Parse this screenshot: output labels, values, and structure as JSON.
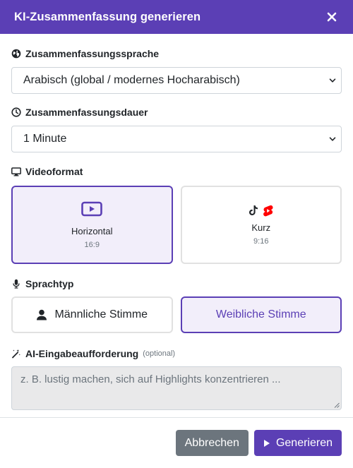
{
  "modal": {
    "title": "KI-Zusammenfassung generieren",
    "close_icon": "close-icon"
  },
  "language": {
    "label": "Zusammenfassungssprache",
    "icon": "globe-icon",
    "selected": "Arabisch (global / modernes Hocharabisch)"
  },
  "duration": {
    "label": "Zusammenfassungsdauer",
    "icon": "clock-icon",
    "selected": "1 Minute"
  },
  "format": {
    "label": "Videoformat",
    "icon": "monitor-icon",
    "options": [
      {
        "name": "Horizontal",
        "ratio": "16:9",
        "icon": "youtube-icon",
        "selected": true
      },
      {
        "name": "Kurz",
        "ratio": "9:16",
        "icon": "tiktok-shorts-icon",
        "selected": false
      }
    ]
  },
  "voice": {
    "label": "Sprachtyp",
    "icon": "microphone-icon",
    "options": [
      {
        "label": "Männliche Stimme",
        "icon": "user-icon",
        "selected": false
      },
      {
        "label": "Weibliche Stimme",
        "selected": true
      }
    ]
  },
  "prompt": {
    "label": "AI-Eingabeaufforderung",
    "optional": "(optional)",
    "icon": "magic-wand-icon",
    "placeholder": "z. B. lustig machen, sich auf Highlights konzentrieren ..."
  },
  "footer": {
    "cancel_label": "Abbrechen",
    "submit_label": "Generieren",
    "submit_icon": "play-icon"
  },
  "colors": {
    "accent": "#5b3fb5",
    "selected_bg": "#f2eefa",
    "tiktok_shorts_red": "#ff0000"
  }
}
